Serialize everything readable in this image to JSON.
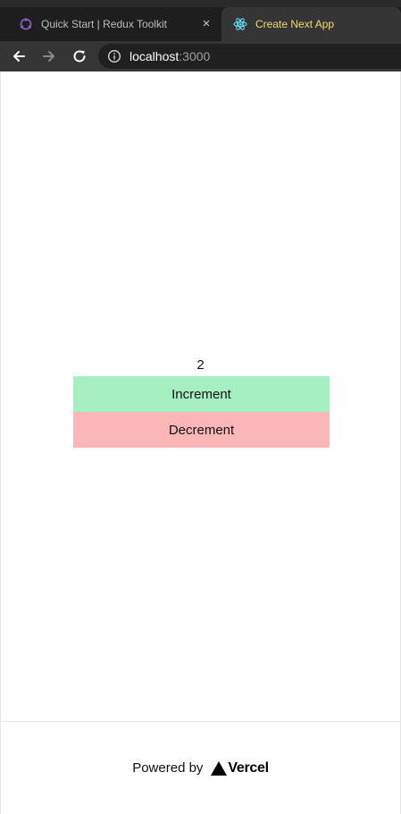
{
  "browser": {
    "tabs": [
      {
        "title": "Quick Start | Redux Toolkit",
        "icon": "redux-icon",
        "active": false
      },
      {
        "title": "Create Next App",
        "icon": "react-icon",
        "active": true
      }
    ],
    "close_symbol": "×",
    "address": {
      "host": "localhost",
      "port": ":3000"
    },
    "colors": {
      "active_tab_title": "#f3d96c",
      "chrome_bg": "#353535"
    }
  },
  "counter": {
    "value": "2",
    "increment_label": "Increment",
    "decrement_label": "Decrement",
    "colors": {
      "increment_bg": "#a6efc1",
      "decrement_bg": "#fbb7b8"
    }
  },
  "footer": {
    "powered_by": "Powered by",
    "brand": "Vercel",
    "brand_icon": "vercel-triangle-icon"
  }
}
